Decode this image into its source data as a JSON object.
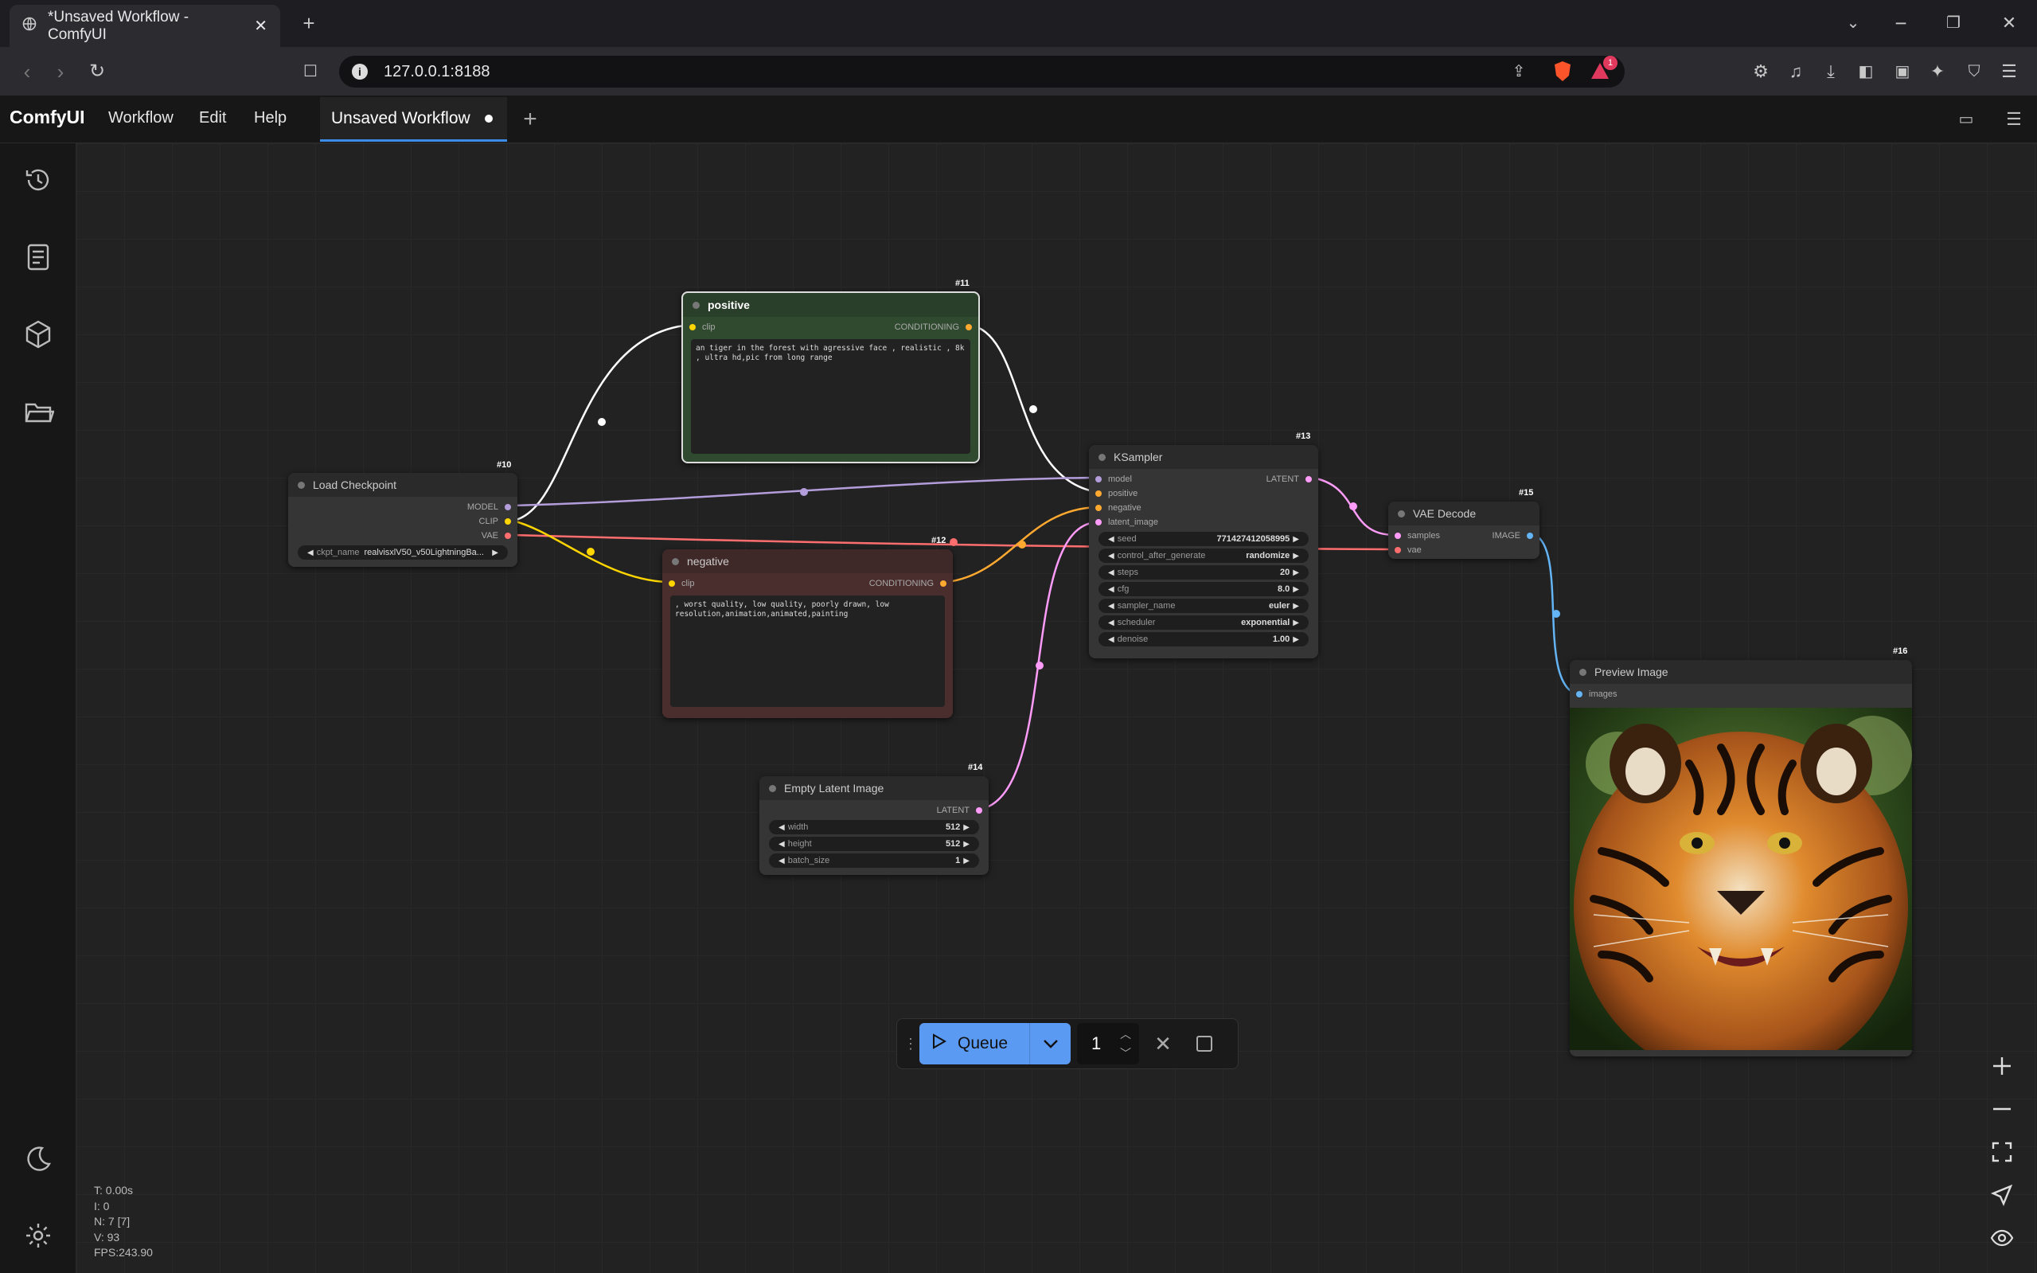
{
  "browser": {
    "tab_title": "*Unsaved Workflow - ComfyUI",
    "url": "127.0.0.1:8188",
    "brave_badge": "1"
  },
  "app": {
    "logo": "ComfyUI",
    "menu": [
      "Workflow",
      "Edit",
      "Help"
    ],
    "workflow_tab": "Unsaved Workflow"
  },
  "sidebar": {
    "icons": [
      "history-icon",
      "queue-list-icon",
      "model-library-icon",
      "workflows-folder-icon"
    ],
    "bottom_icons": [
      "theme-toggle-icon",
      "settings-icon"
    ]
  },
  "nodes": {
    "load_checkpoint": {
      "id": "#10",
      "title": "Load Checkpoint",
      "outputs": [
        "MODEL",
        "CLIP",
        "VAE"
      ],
      "widget_label": "ckpt_name",
      "widget_value": "realvisxlV50_v50LightningBa..."
    },
    "positive": {
      "id": "#11",
      "title": "positive",
      "input": "clip",
      "output": "CONDITIONING",
      "text": "an tiger in the forest with agressive face , realistic , 8k , ultra hd,pic from long range"
    },
    "negative": {
      "id": "#12",
      "title": "negative",
      "input": "clip",
      "output": "CONDITIONING",
      "text": ", worst quality, low quality, poorly drawn, low resolution,animation,animated,painting"
    },
    "ksampler": {
      "id": "#13",
      "title": "KSampler",
      "inputs": [
        "model",
        "positive",
        "negative",
        "latent_image"
      ],
      "output": "LATENT",
      "widgets": [
        {
          "label": "seed",
          "value": "771427412058995"
        },
        {
          "label": "control_after_generate",
          "value": "randomize"
        },
        {
          "label": "steps",
          "value": "20"
        },
        {
          "label": "cfg",
          "value": "8.0"
        },
        {
          "label": "sampler_name",
          "value": "euler"
        },
        {
          "label": "scheduler",
          "value": "exponential"
        },
        {
          "label": "denoise",
          "value": "1.00"
        }
      ]
    },
    "empty_latent": {
      "id": "#14",
      "title": "Empty Latent Image",
      "output": "LATENT",
      "widgets": [
        {
          "label": "width",
          "value": "512"
        },
        {
          "label": "height",
          "value": "512"
        },
        {
          "label": "batch_size",
          "value": "1"
        }
      ]
    },
    "vae_decode": {
      "id": "#15",
      "title": "VAE Decode",
      "inputs": [
        "samples",
        "vae"
      ],
      "output": "IMAGE"
    },
    "preview_image": {
      "id": "#16",
      "title": "Preview Image",
      "input": "images"
    }
  },
  "queue": {
    "label": "Queue",
    "count": "1"
  },
  "stats": {
    "t": "T: 0.00s",
    "i": "I: 0",
    "n": "N: 7 [7]",
    "v": "V: 93",
    "fps": "FPS:243.90"
  },
  "colors": {
    "accent": "#5b9af2",
    "clip": "#ffd500",
    "model": "#b39ddb",
    "vae": "#ff6e6e",
    "conditioning": "#ffa931",
    "latent": "#ff9cf9",
    "image": "#64b5f6",
    "positive_node": "#2f4a2f",
    "negative_node": "#4a2d2d"
  }
}
